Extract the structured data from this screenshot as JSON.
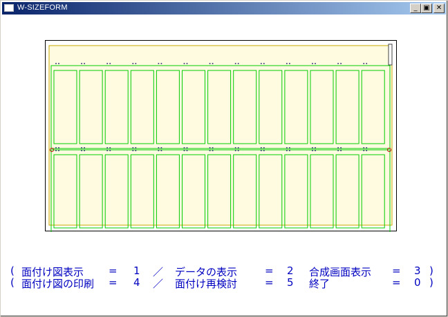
{
  "window": {
    "title": "W-SIZEFORM",
    "controls": {
      "minimize": "_",
      "maximize": "▣",
      "close": "✕"
    }
  },
  "layout_sheet": {
    "columns": 13,
    "rows": 2,
    "colors": {
      "sheet_border": "#000000",
      "paper_fill": "#fff8dc",
      "paper_border": "#c8a800",
      "piece_border": "#00cc00",
      "mark_color": "#404080",
      "side_mark": "#c00000"
    }
  },
  "menu_legend": {
    "row1": {
      "open_paren": "(",
      "item1_label": "面付け図表示",
      "item1_eq": "=",
      "item1_key": "1",
      "sep1": "／",
      "item2_label": "データの表示",
      "item2_eq": "=",
      "item2_key": "2",
      "item3_label": "合成画面表示",
      "item3_eq": "=",
      "item3_key": "3",
      "close_paren": ")"
    },
    "row2": {
      "open_paren": "(",
      "item4_label": "面付け図の印刷",
      "item4_eq": "=",
      "item4_key": "4",
      "sep2": "／",
      "item5_label": "面付け再検討",
      "item5_eq": "=",
      "item5_key": "5",
      "item0_label": "終了",
      "item0_eq": "=",
      "item0_key": "0",
      "close_paren": ")"
    },
    "text_color": "#0000c0"
  }
}
